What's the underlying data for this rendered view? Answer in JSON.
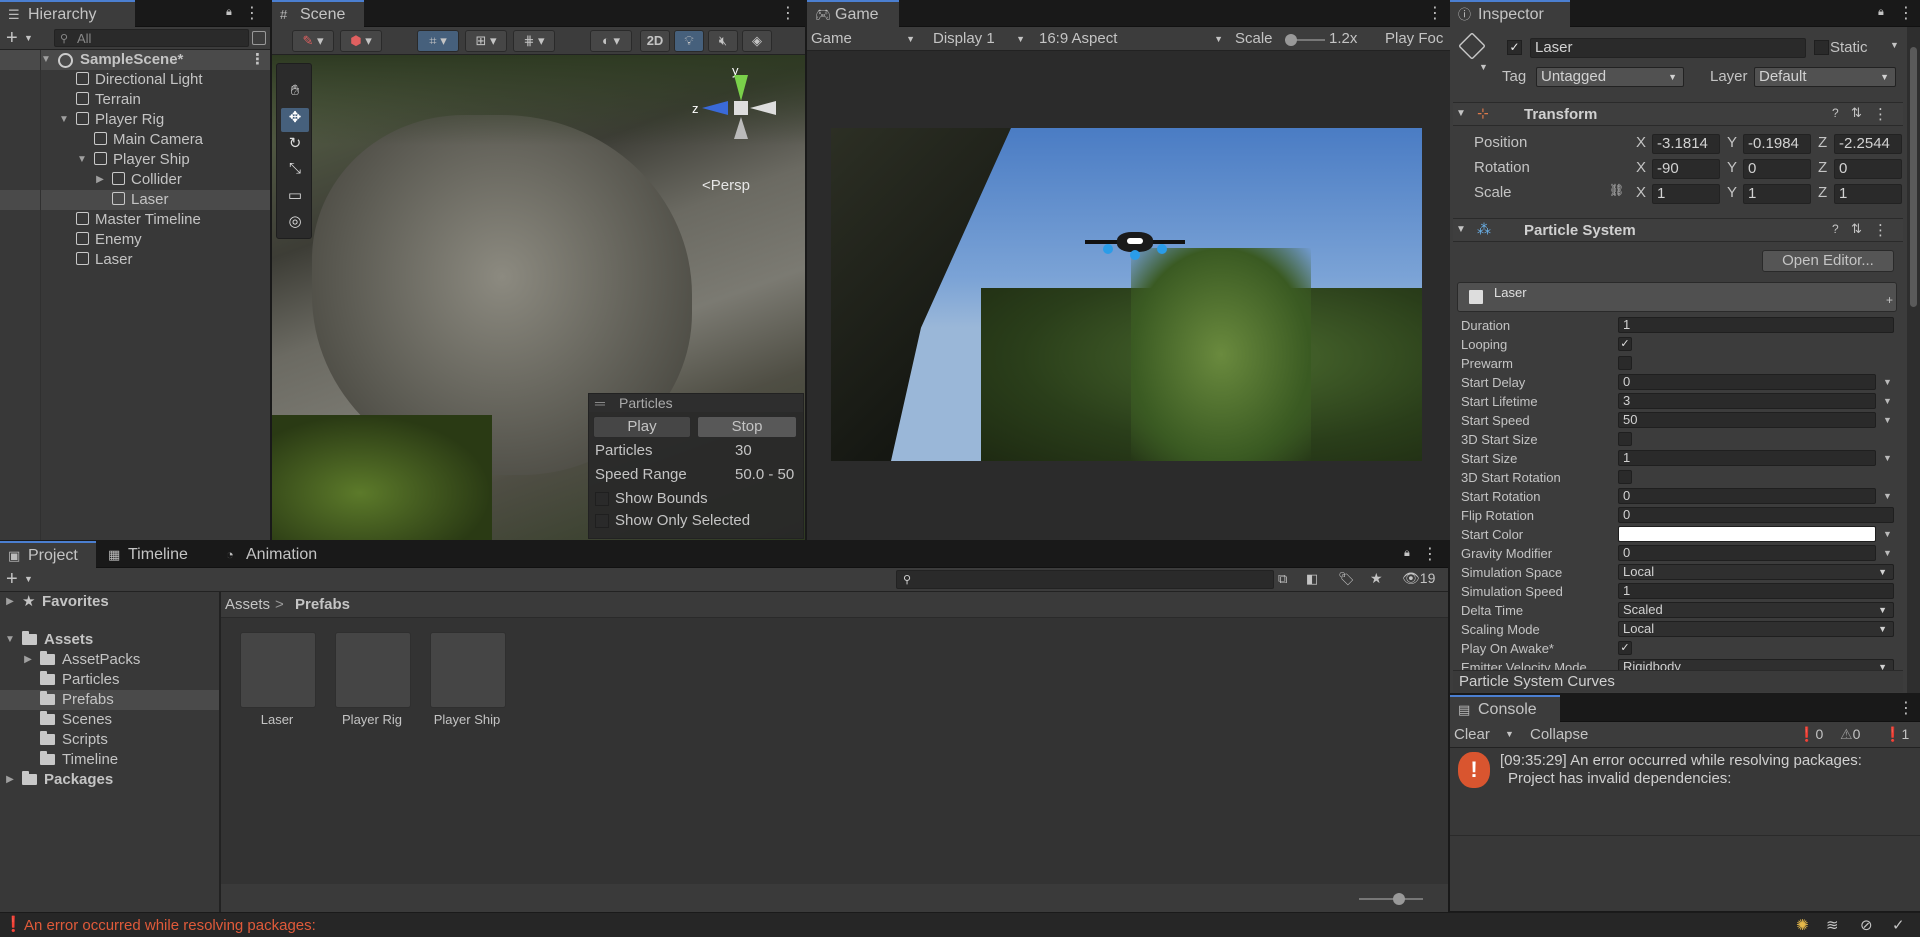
{
  "hierarchy": {
    "tab": "Hierarchy",
    "search_placeholder": "All",
    "items": [
      {
        "label": "SampleScene*",
        "bold": true
      },
      {
        "label": "Directional Light"
      },
      {
        "label": "Terrain"
      },
      {
        "label": "Player Rig"
      },
      {
        "label": "Main Camera"
      },
      {
        "label": "Player Ship"
      },
      {
        "label": "Collider"
      },
      {
        "label": "Laser"
      },
      {
        "label": "Master Timeline"
      },
      {
        "label": "Enemy"
      },
      {
        "label": "Laser"
      }
    ]
  },
  "scene": {
    "tab": "Scene",
    "btn_2d": "2D",
    "persp": "Persp",
    "gizmo_y": "y",
    "gizmo_z": "z",
    "particles_overlay": {
      "title": "Particles",
      "play": "Play",
      "stop": "Stop",
      "particles_label": "Particles",
      "particles_value": "30",
      "speed_label": "Speed Range",
      "speed_value": "50.0 - 50",
      "show_bounds": "Show Bounds",
      "show_only_selected": "Show Only Selected"
    }
  },
  "game": {
    "tab": "Game",
    "mode": "Game",
    "display": "Display 1",
    "aspect": "16:9 Aspect",
    "scale_label": "Scale",
    "scale_value": "1.2x",
    "play_focused": "Play Foc"
  },
  "inspector": {
    "tab": "Inspector",
    "object_name": "Laser",
    "static_label": "Static",
    "tag_label": "Tag",
    "tag_value": "Untagged",
    "layer_label": "Layer",
    "layer_value": "Default",
    "transform": {
      "title": "Transform",
      "position_label": "Position",
      "rotation_label": "Rotation",
      "scale_label": "Scale",
      "position": {
        "x": "-3.1814",
        "y": "-0.1984",
        "z": "-2.2544"
      },
      "rotation": {
        "x": "-90",
        "y": "0",
        "z": "0"
      },
      "scale": {
        "x": "1",
        "y": "1",
        "z": "1"
      },
      "axis_x": "X",
      "axis_y": "Y",
      "axis_z": "Z"
    },
    "particle_system": {
      "title": "Particle System",
      "open_editor": "Open Editor...",
      "module_name": "Laser",
      "properties": [
        {
          "label": "Duration",
          "value": "1",
          "kind": "field"
        },
        {
          "label": "Looping",
          "value": "✓",
          "kind": "check"
        },
        {
          "label": "Prewarm",
          "value": "",
          "kind": "check"
        },
        {
          "label": "Start Delay",
          "value": "0",
          "kind": "field-arrow"
        },
        {
          "label": "Start Lifetime",
          "value": "3",
          "kind": "field-arrow"
        },
        {
          "label": "Start Speed",
          "value": "50",
          "kind": "field-arrow"
        },
        {
          "label": "3D Start Size",
          "value": "",
          "kind": "check"
        },
        {
          "label": "Start Size",
          "value": "1",
          "kind": "field-arrow"
        },
        {
          "label": "3D Start Rotation",
          "value": "",
          "kind": "check"
        },
        {
          "label": "Start Rotation",
          "value": "0",
          "kind": "field-arrow"
        },
        {
          "label": "Flip Rotation",
          "value": "0",
          "kind": "field"
        },
        {
          "label": "Start Color",
          "value": "",
          "kind": "color"
        },
        {
          "label": "Gravity Modifier",
          "value": "0",
          "kind": "field-arrow"
        },
        {
          "label": "Simulation Space",
          "value": "Local",
          "kind": "dropdown"
        },
        {
          "label": "Simulation Speed",
          "value": "1",
          "kind": "field"
        },
        {
          "label": "Delta Time",
          "value": "Scaled",
          "kind": "dropdown"
        },
        {
          "label": "Scaling Mode",
          "value": "Local",
          "kind": "dropdown"
        },
        {
          "label": "Play On Awake*",
          "value": "✓",
          "kind": "check"
        },
        {
          "label": "Emitter Velocity Mode",
          "value": "Rigidbody",
          "kind": "dropdown"
        }
      ],
      "curves_label": "Particle System Curves"
    }
  },
  "project": {
    "tabs": [
      "Project",
      "Timeline",
      "Animation"
    ],
    "tree": [
      {
        "label": "Favorites"
      },
      {
        "label": "Assets"
      },
      {
        "label": "AssetPacks"
      },
      {
        "label": "Particles"
      },
      {
        "label": "Prefabs"
      },
      {
        "label": "Scenes"
      },
      {
        "label": "Scripts"
      },
      {
        "label": "Timeline"
      },
      {
        "label": "Packages"
      }
    ],
    "breadcrumb_root": "Assets",
    "breadcrumb_sep": ">",
    "breadcrumb_current": "Prefabs",
    "hidden_count": "19",
    "assets": [
      "Laser",
      "Player Rig",
      "Player Ship"
    ]
  },
  "console": {
    "tab": "Console",
    "clear": "Clear",
    "collapse": "Collapse",
    "count_info": "0",
    "count_warn": "0",
    "count_error": "1",
    "message_line1": "[09:35:29] An error occurred while resolving packages:",
    "message_line2": "Project has invalid dependencies:"
  },
  "status_bar": {
    "message": "An error occurred while resolving packages:"
  },
  "colors": {
    "accent": "#4b7fd1",
    "error": "#e05a3a",
    "panel": "#383838"
  }
}
